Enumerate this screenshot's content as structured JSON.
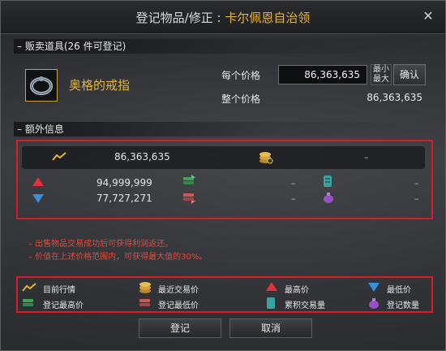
{
  "title": {
    "prefix": "登记物品/修正 : ",
    "highlight": "卡尔佩恩自治领"
  },
  "sale_section": {
    "header": "– 贩卖道具(26 件可登记)",
    "item_name": "奥格的戒指",
    "unit_price_label": "每个价格",
    "unit_price_value": "86,363,635",
    "minmax_label_top": "最小",
    "minmax_label_bottom": "最大",
    "confirm_label": "确认",
    "total_price_label": "整个价格",
    "total_price_value": "86,363,635"
  },
  "extra_section": {
    "header": "– 额外信息",
    "current_market": "86,363,635",
    "recent_trade": "–",
    "highest_price": "94,999,999",
    "lowest_price": "77,727,271",
    "registered_highest": "–",
    "registered_lowest": "–",
    "cumulative_volume": "–",
    "registered_count": "–"
  },
  "warnings": [
    "– 出售物品交易成功后可获得利润返还。",
    "– 价值在上述价格范围内，可获得最大值的30%。"
  ],
  "legend": {
    "current_market": "目前行情",
    "recent_trade": "最近交易价",
    "highest": "最高价",
    "lowest": "最低价",
    "registered_highest": "登记最高价",
    "registered_lowest": "登记最低价",
    "cumulative_volume": "累积交易量",
    "registered_count": "登记数量"
  },
  "buttons": {
    "register": "登记",
    "cancel": "取消",
    "close": "✕"
  },
  "colors": {
    "accent_gold": "#e4b13a",
    "highlight_red": "#d0202a",
    "warning_text": "#e24a3b"
  }
}
